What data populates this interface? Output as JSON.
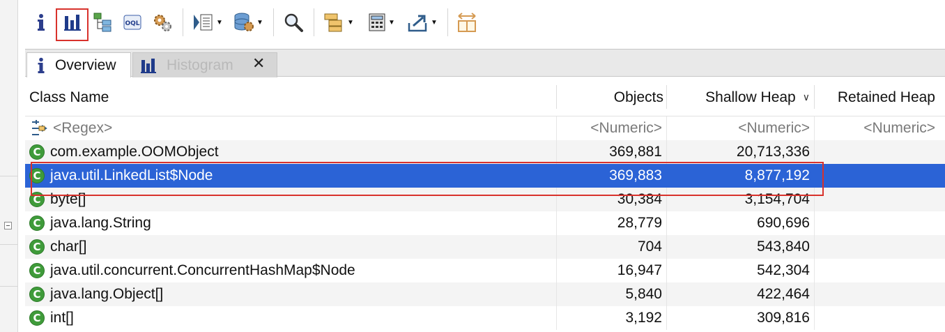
{
  "toolbar": {
    "icons": [
      "info-icon",
      "histogram-icon",
      "dominator-tree-icon",
      "oql-icon",
      "settings-gears-icon",
      "query-browser-icon",
      "heap-dump-overview-icon",
      "search-icon",
      "group-by-icon",
      "calculator-icon",
      "export-icon",
      "layout-icon"
    ],
    "selected": "histogram-icon"
  },
  "tabs": [
    {
      "label": "Overview",
      "icon": "info-icon",
      "active": true
    },
    {
      "label": "Histogram",
      "icon": "histogram-icon",
      "active": false
    }
  ],
  "table": {
    "columns": [
      "Class Name",
      "Objects",
      "Shallow Heap",
      "Retained Heap"
    ],
    "sort_column": "Shallow Heap",
    "sort_direction": "descending",
    "filter": {
      "name": "<Regex>",
      "objects": "<Numeric>",
      "shallow": "<Numeric>",
      "retained": "<Numeric>"
    },
    "rows": [
      {
        "name": "com.example.OOMObject",
        "objects": "369,881",
        "shallow": "20,713,336",
        "retained": ""
      },
      {
        "name": "java.util.LinkedList$Node",
        "objects": "369,883",
        "shallow": "8,877,192",
        "retained": ""
      },
      {
        "name": "byte[]",
        "objects": "30,384",
        "shallow": "3,154,704",
        "retained": ""
      },
      {
        "name": "java.lang.String",
        "objects": "28,779",
        "shallow": "690,696",
        "retained": ""
      },
      {
        "name": "char[]",
        "objects": "704",
        "shallow": "543,840",
        "retained": ""
      },
      {
        "name": "java.util.concurrent.ConcurrentHashMap$Node",
        "objects": "16,947",
        "shallow": "542,304",
        "retained": ""
      },
      {
        "name": "java.lang.Object[]",
        "objects": "5,840",
        "shallow": "422,464",
        "retained": ""
      },
      {
        "name": "int[]",
        "objects": "3,192",
        "shallow": "309,816",
        "retained": ""
      }
    ],
    "selected_row": "java.util.LinkedList$Node"
  },
  "colors": {
    "selection": "#2b63d6",
    "highlight_border": "#d8322c",
    "class_icon": "#3f9b3a"
  }
}
